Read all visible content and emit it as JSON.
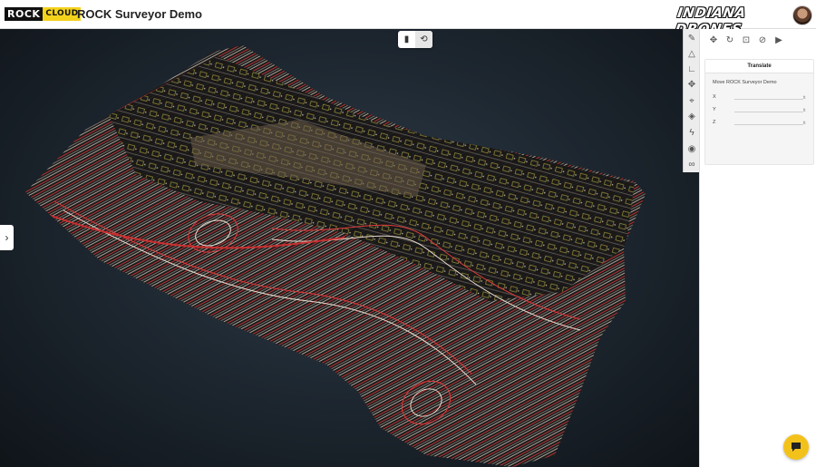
{
  "header": {
    "logo": {
      "part1": "ROCK",
      "part2": "CLOUD"
    },
    "title": "ROCK Surveyor Demo",
    "brand": "INDIANA DRONES",
    "avatar_icon": "user-avatar"
  },
  "viewport": {
    "view_toggle": [
      "map-icon",
      "3d-orbit-icon"
    ],
    "expand_icon": "chevron-right-icon"
  },
  "tool_strip": [
    "pencil-icon",
    "area-triangle-icon",
    "angle-icon",
    "move-icon",
    "location-pin-icon",
    "layers-icon",
    "flash-icon",
    "eye-icon",
    "link-icon"
  ],
  "panel": {
    "top_icons": [
      "translate-icon",
      "rotate-icon",
      "scale-icon",
      "compass-icon",
      "camera-icon"
    ],
    "tab": "Translate",
    "subtitle": "Move ROCK Surveyor Demo",
    "axes": [
      {
        "label": "X",
        "unit": "ft"
      },
      {
        "label": "Y",
        "unit": "ft"
      },
      {
        "label": "Z",
        "unit": "ft"
      }
    ]
  },
  "chat_icon": "chat-bubble-icon",
  "colors": {
    "accent": "#f3c21a",
    "contour_red": "#e0393b",
    "contour_white": "#e8dccf",
    "contour_yellow": "#d9d24a"
  }
}
